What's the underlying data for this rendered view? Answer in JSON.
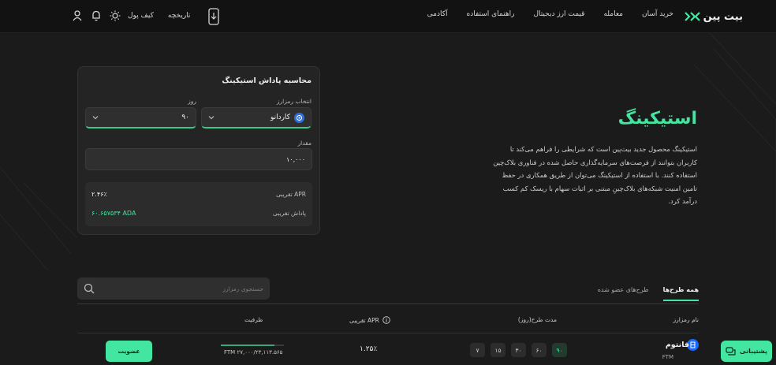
{
  "header": {
    "brand": "بیت پین",
    "nav": [
      "خرید آسان",
      "معامله",
      "قیمت ارز دیجیتال",
      "راهنمای استفاده",
      "آکادمی"
    ],
    "wallet_label": "کیف پول",
    "history_label": "تاریخچه"
  },
  "hero": {
    "title": "استیکینگ",
    "description": "استیکینگ محصول جدید بیت‌پین است که شرایطی را فراهم می‌کند تا کاربران بتوانند از فرصت‌های سرمایه‌گذاری حاصل شده در فناوری بلاک‌چین استفاده کنند. با استفاده از استیکینگ می‌توان از طریق همکاری در حفظ تامین امنیت شبکه‌های بلاک‌چینِ مبتنی بر اثبات سهام با ریسک کم کسب درآمد کرد."
  },
  "calculator": {
    "title": "محاسبه پاداش استیکینگ",
    "coin_label": "انتخاب رمزارز",
    "coin_value": "کاردانو",
    "days_label": "روز",
    "days_value": "۹۰",
    "amount_label": "مقدار",
    "amount_value": "۱۰,۰۰۰",
    "apr_label": "APR تقریبی",
    "apr_value": "۲.۴۶٪",
    "reward_label": "پاداش تقریبی",
    "reward_value": "۶۰.۶۵۷۵۳۴ ADA"
  },
  "plans": {
    "search_placeholder": "جستجوی رمزارز",
    "tabs": [
      "همه طرح‌ها",
      "طرح‌های عضو شده"
    ],
    "columns": {
      "name": "نام رمزارز",
      "duration": "مدت طرح(روز)",
      "apr": "APR تقریبی",
      "capacity": "ظرفیت"
    },
    "rows": [
      {
        "name": "فانتوم",
        "symbol": "FTM",
        "durations": [
          "۷",
          "۱۵",
          "۳۰",
          "۶۰",
          "۹۰"
        ],
        "active_duration_index": 4,
        "apr": "۱.۲۵٪",
        "capacity_text": "FTM ۲۷,۰۰۰/۲۳,۱۱۳.۵۶۵",
        "capacity_fraction": 0.856,
        "join_label": "عضویت"
      }
    ]
  },
  "support_label": "پشتیبانی",
  "colors": {
    "accent": "#43e6a0",
    "bg": "#1b1b1b",
    "card": "#242424"
  }
}
